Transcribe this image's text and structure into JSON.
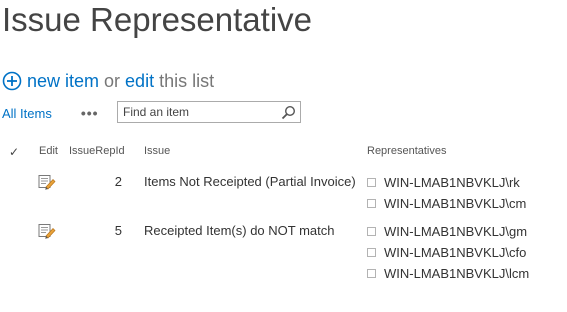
{
  "page": {
    "title": "Issue Representative"
  },
  "command_bar": {
    "new_item": "new item",
    "or": "or",
    "edit": "edit",
    "this_list": "this list"
  },
  "views": {
    "all_items": "All Items",
    "more": "•••"
  },
  "search": {
    "placeholder": "Find an item"
  },
  "columns": {
    "select": "✓",
    "edit": "Edit",
    "id": "IssueRepId",
    "issue": "Issue",
    "representatives": "Representatives"
  },
  "rows": [
    {
      "id": "2",
      "issue": "Items Not Receipted (Partial Invoice)",
      "representatives": [
        "WIN-LMAB1NBVKLJ\\rk",
        "WIN-LMAB1NBVKLJ\\cm"
      ]
    },
    {
      "id": "5",
      "issue": "Receipted Item(s) do NOT match",
      "representatives": [
        "WIN-LMAB1NBVKLJ\\gm",
        "WIN-LMAB1NBVKLJ\\cfo",
        "WIN-LMAB1NBVKLJ\\lcm"
      ]
    }
  ],
  "colors": {
    "link": "#0072c6",
    "text": "#444444"
  },
  "icons": {
    "add": "plus-circle-icon",
    "search": "magnifier-icon",
    "edit": "edit-document-icon"
  }
}
